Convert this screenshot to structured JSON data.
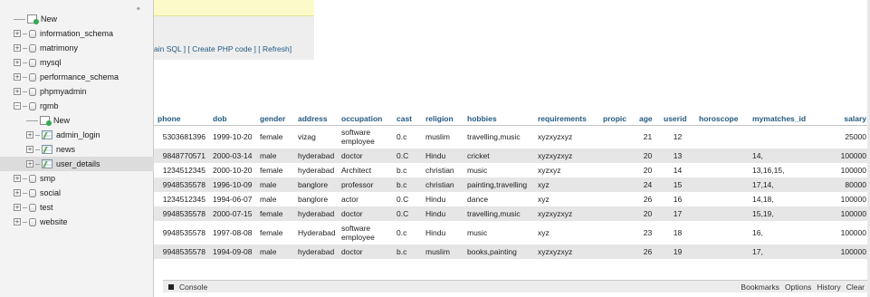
{
  "navigation": {
    "collapse_glyph": "⚭",
    "items": [
      {
        "label": "New",
        "kind": "new",
        "indent": 0,
        "expander": ""
      },
      {
        "label": "information_schema",
        "kind": "db",
        "indent": 0,
        "expander": "+"
      },
      {
        "label": "matrimony",
        "kind": "db",
        "indent": 0,
        "expander": "+"
      },
      {
        "label": "mysql",
        "kind": "db",
        "indent": 0,
        "expander": "+"
      },
      {
        "label": "performance_schema",
        "kind": "db",
        "indent": 0,
        "expander": "+"
      },
      {
        "label": "phpmyadmin",
        "kind": "db",
        "indent": 0,
        "expander": "+"
      },
      {
        "label": "rgmb",
        "kind": "db",
        "indent": 0,
        "expander": "−"
      },
      {
        "label": "New",
        "kind": "new",
        "indent": 1,
        "expander": ""
      },
      {
        "label": "admin_login",
        "kind": "table",
        "indent": 1,
        "expander": "+"
      },
      {
        "label": "news",
        "kind": "table",
        "indent": 1,
        "expander": "+"
      },
      {
        "label": "user_details",
        "kind": "table",
        "indent": 1,
        "expander": "+",
        "selected": true
      },
      {
        "label": "smp",
        "kind": "db",
        "indent": 0,
        "expander": "+"
      },
      {
        "label": "social",
        "kind": "db",
        "indent": 0,
        "expander": "+"
      },
      {
        "label": "test",
        "kind": "db",
        "indent": 0,
        "expander": "+"
      },
      {
        "label": "website",
        "kind": "db",
        "indent": 0,
        "expander": "+"
      }
    ]
  },
  "query_panel": {
    "links_text": "ain SQL ] [ Create PHP code ] [ Refresh]"
  },
  "results": {
    "columns": [
      "phone",
      "dob",
      "gender",
      "address",
      "occupation",
      "cast",
      "religion",
      "hobbies",
      "requirements",
      "propic",
      "age",
      "userid",
      "horoscope",
      "mymatches_id",
      "salary"
    ],
    "rows": [
      [
        "5303681396",
        "1999-10-20",
        "female",
        "vizag",
        "software employee",
        "0.c",
        "muslim",
        "travelling,music",
        "xyzxyzxyz",
        "",
        "21",
        "12",
        "",
        "",
        "25000"
      ],
      [
        "9848770571",
        "2000-03-14",
        "male",
        "hyderabad",
        "doctor",
        "0.C",
        "Hindu",
        "cricket",
        "xyzxyzxyz",
        "",
        "20",
        "13",
        "",
        "14,",
        "100000"
      ],
      [
        "1234512345",
        "2000-10-20",
        "female",
        "hyderabad",
        "Architect",
        "b.c",
        "christian",
        "music",
        "xyzxyz",
        "",
        "20",
        "14",
        "",
        "13,16,15,",
        "100000"
      ],
      [
        "9948535578",
        "1996-10-09",
        "male",
        "banglore",
        "professor",
        "b.c",
        "christian",
        "painting,travelling",
        "xyz",
        "",
        "24",
        "15",
        "",
        "17,14,",
        "80000"
      ],
      [
        "1234512345",
        "1994-06-07",
        "male",
        "banglore",
        "actor",
        "0.C",
        "Hindu",
        "dance",
        "xyz",
        "",
        "26",
        "16",
        "",
        "14,18,",
        "100000"
      ],
      [
        "9948535578",
        "2000-07-15",
        "female",
        "hyderabad",
        "doctor",
        "0.C",
        "Hindu",
        "travelling,music",
        "xyzxyzxyz",
        "",
        "20",
        "17",
        "",
        "15,19,",
        "100000"
      ],
      [
        "9948535578",
        "1997-08-08",
        "female",
        "Hyderabad",
        "software employee",
        "0.c",
        "Hindu",
        "music",
        "xyz",
        "",
        "23",
        "18",
        "",
        "16,",
        "100000"
      ],
      [
        "9948535578",
        "1994-09-08",
        "male",
        "hyderabad",
        "doctor",
        "b.c",
        "muslim",
        "books,painting",
        "xyzxyzxyz",
        "",
        "26",
        "19",
        "",
        "17,",
        "100000"
      ]
    ]
  },
  "console": {
    "label": "Console",
    "buttons": [
      "Bookmarks",
      "Options",
      "History",
      "Clear"
    ]
  }
}
